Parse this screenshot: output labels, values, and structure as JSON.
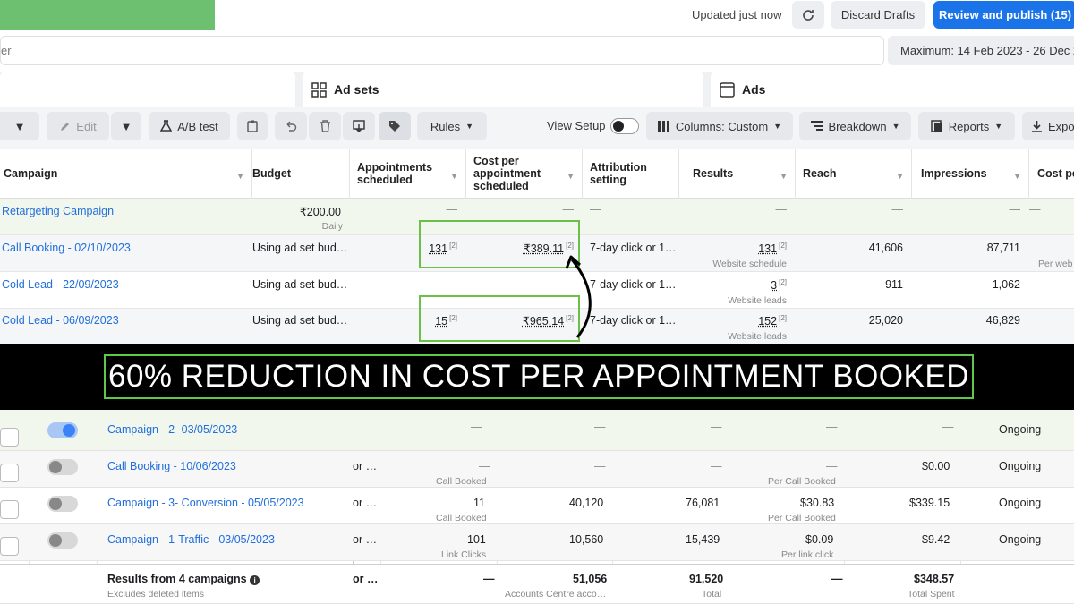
{
  "topbar": {
    "status": "Updated just now",
    "discard_label": "Discard Drafts",
    "publish_label": "Review and publish (15)"
  },
  "search": {
    "partial_placeholder": "er"
  },
  "date_range": "Maximum: 14 Feb 2023 - 26 Dec 20",
  "tabs": {
    "ad_sets": "Ad sets",
    "ads": "Ads"
  },
  "toolbar": {
    "edit": "Edit",
    "ab_test": "A/B test",
    "rules": "Rules",
    "view_setup": "View Setup",
    "columns": "Columns: Custom",
    "breakdown": "Breakdown",
    "reports": "Reports",
    "export": "Expo"
  },
  "columns": {
    "campaign": "Campaign",
    "budget": "Budget",
    "appointments": "Appointments scheduled",
    "cost_per": "Cost per appointment scheduled",
    "attribution": "Attribution setting",
    "results": "Results",
    "reach": "Reach",
    "impressions": "Impressions",
    "cost_pe": "Cost pe"
  },
  "rows": [
    {
      "name": "Retargeting Campaign",
      "budget": "₹200.00",
      "budget_sub": "Daily",
      "appointments": "—",
      "cost": "—",
      "attribution": "—",
      "results": "—",
      "results_sub": "",
      "reach": "—",
      "impressions": "—",
      "cost_pe": "—"
    },
    {
      "name": "Call Booking - 02/10/2023",
      "budget": "Using ad set bud…",
      "appointments": "131",
      "cost": "₹389.11",
      "attribution": "7-day click or 1…",
      "results": "131",
      "results_sub": "Website schedule",
      "reach": "41,606",
      "impressions": "87,711",
      "cost_pe_sub": "Per web"
    },
    {
      "name": "Cold Lead - 22/09/2023",
      "budget": "Using ad set bud…",
      "appointments": "—",
      "cost": "—",
      "attribution": "7-day click or 1…",
      "results": "3",
      "results_sub": "Website leads",
      "reach": "911",
      "impressions": "1,062"
    },
    {
      "name": "Cold Lead - 06/09/2023",
      "budget": "Using ad set bud…",
      "appointments": "15",
      "cost": "₹965.14",
      "attribution": "7-day click or 1…",
      "results": "152",
      "results_sub": "Website leads",
      "reach": "25,020",
      "impressions": "46,829"
    }
  ],
  "superscript": "[2]",
  "banner": "60% REDUCTION IN COST PER APPOINTMENT BOOKED",
  "bottom_rows": [
    {
      "name": "Campaign - 2- 03/05/2023",
      "budget": "",
      "results": "—",
      "results_sub": "",
      "reach": "—",
      "impressions": "—",
      "cost": "—",
      "cost_sub": "",
      "spent": "—",
      "status": "Ongoing"
    },
    {
      "name": "Call Booking - 10/06/2023",
      "budget": "or …",
      "results": "—",
      "results_sub": "Call Booked",
      "reach": "—",
      "impressions": "—",
      "cost": "—",
      "cost_sub": "Per Call Booked",
      "spent": "$0.00",
      "status": "Ongoing"
    },
    {
      "name": "Campaign - 3- Conversion - 05/05/2023",
      "budget": "or …",
      "results": "11",
      "results_sub": "Call Booked",
      "reach": "40,120",
      "impressions": "76,081",
      "cost": "$30.83",
      "cost_sub": "Per Call Booked",
      "spent": "$339.15",
      "status": "Ongoing"
    },
    {
      "name": "Campaign - 1-Traffic - 03/05/2023",
      "budget": "or …",
      "results": "101",
      "results_sub": "Link Clicks",
      "reach": "10,560",
      "impressions": "15,439",
      "cost": "$0.09",
      "cost_sub": "Per link click",
      "spent": "$9.42",
      "status": "Ongoing"
    }
  ],
  "summary": {
    "title": "Results from 4 campaigns",
    "subtitle": "Excludes deleted items",
    "budget": "or …",
    "results": "—",
    "reach": "51,056",
    "reach_sub": "Accounts Centre acco…",
    "impressions": "91,520",
    "impressions_sub": "Total",
    "cost": "—",
    "spent": "$348.57",
    "spent_sub": "Total Spent"
  },
  "colors": {
    "accent_green": "#6cc04a",
    "publish_blue": "#1a73e8",
    "link_blue": "#216fdb"
  }
}
